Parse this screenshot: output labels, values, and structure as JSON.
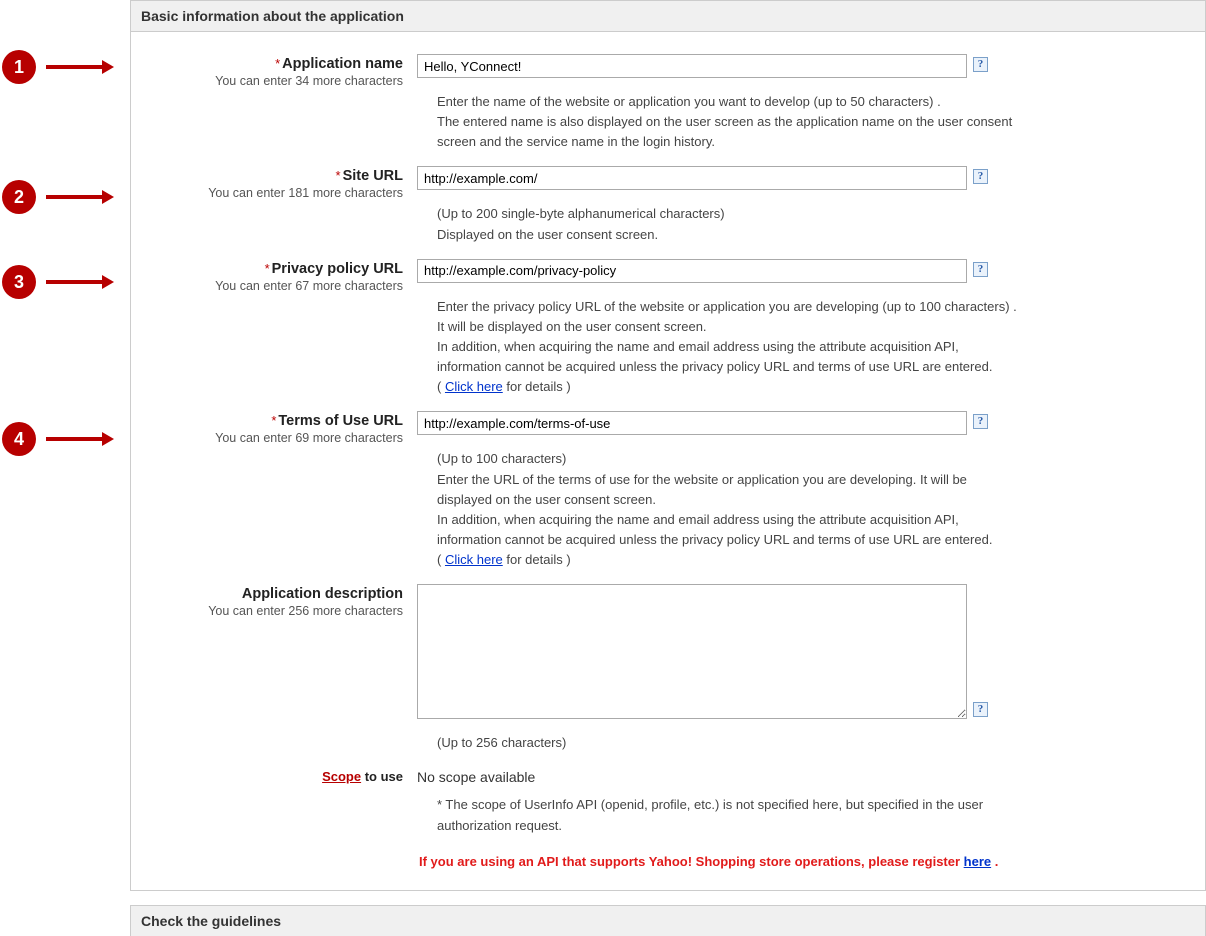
{
  "panel1_title": "Basic information about the application",
  "panel2_title": "Check the guidelines",
  "callouts": {
    "n1": "1",
    "n2": "2",
    "n3": "3",
    "n4": "4"
  },
  "fields": {
    "appname": {
      "label": "Application name",
      "charcount": "You can enter 34 more characters",
      "value": "Hello, YConnect!",
      "desc1": "Enter the name of the website or application you want to develop (up to 50 characters) .",
      "desc2": "The entered name is also displayed on the user screen as the application name on the user consent screen and the service name in the login history."
    },
    "siteurl": {
      "label": "Site URL",
      "charcount": "You can enter 181 more characters",
      "value": "http://example.com/",
      "desc1": "(Up to 200 single-byte alphanumerical characters)",
      "desc2": "Displayed on the user consent screen."
    },
    "privacy": {
      "label": "Privacy policy URL",
      "charcount": "You can enter 67 more characters",
      "value": "http://example.com/privacy-policy",
      "desc1": "Enter the privacy policy URL of the website or application you are developing (up to 100 characters) . It will be displayed on the user consent screen.",
      "desc2": "In addition, when acquiring the name and email address using the attribute acquisition API, information cannot be acquired unless the privacy policy URL and terms of use URL are entered.",
      "desc3a": "( ",
      "desc3_link": "Click here",
      "desc3b": " for details )"
    },
    "terms": {
      "label": "Terms of Use URL",
      "charcount": "You can enter 69 more characters",
      "value": "http://example.com/terms-of-use",
      "desc0": "(Up to 100 characters)",
      "desc1": "Enter the URL of the terms of use for the website or application you are developing. It will be displayed on the user consent screen.",
      "desc2": "In addition, when acquiring the name and email address using the attribute acquisition API, information cannot be acquired unless the privacy policy URL and terms of use URL are entered.",
      "desc3a": "( ",
      "desc3_link": "Click here",
      "desc3b": " for details )"
    },
    "appdesc": {
      "label": "Application description",
      "charcount": "You can enter 256 more characters",
      "value": "",
      "desc1": "(Up to 256 characters)"
    },
    "scope": {
      "label_link": "Scope",
      "label_rest": " to use",
      "noscope": "No scope available",
      "star": "* The scope of UserInfo API (openid, profile, etc.) is not specified here, but specified in the user authorization request.",
      "warn_a": "If you are using an API that supports Yahoo! Shopping store operations, please register ",
      "warn_link": "here",
      "warn_b": " ."
    }
  },
  "help_glyph": "?"
}
